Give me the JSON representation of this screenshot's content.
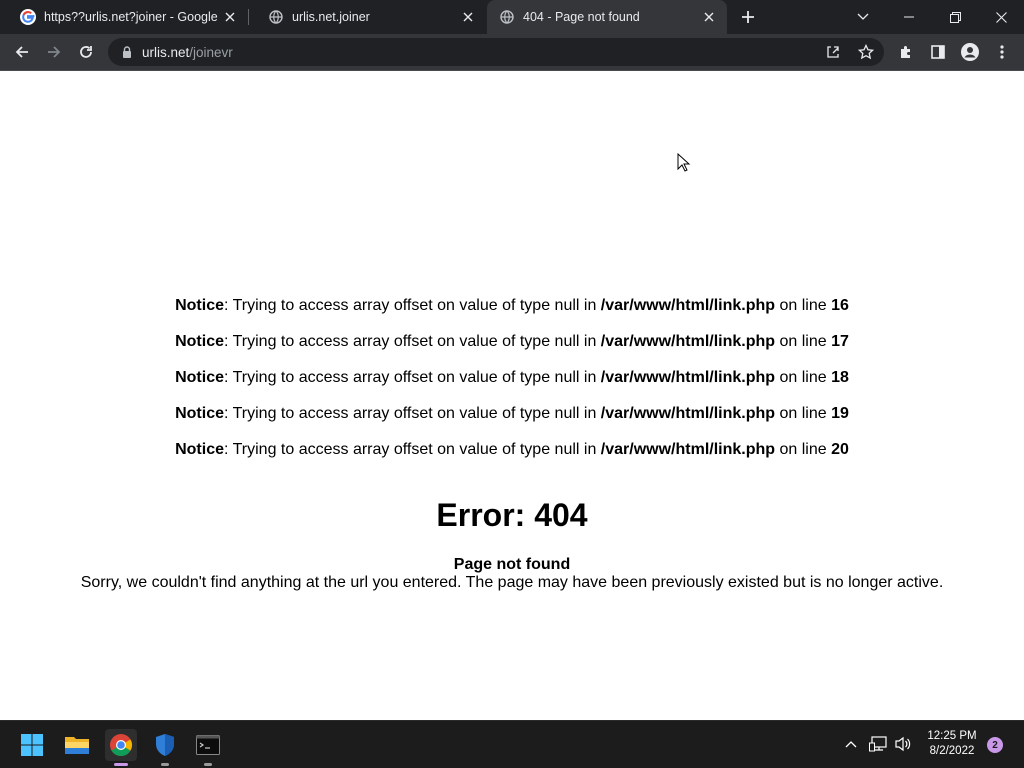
{
  "browser": {
    "tabs": [
      {
        "title": "https??urlis.net?joiner - Google S",
        "icon": "google-icon",
        "active": false
      },
      {
        "title": "urlis.net.joiner",
        "icon": "globe-icon",
        "active": false
      },
      {
        "title": "404 - Page not found",
        "icon": "globe-icon",
        "active": true
      }
    ],
    "address": {
      "host": "urlis.net",
      "path": "/joinevr"
    }
  },
  "page": {
    "notices": [
      {
        "label": "Notice",
        "message": ": Trying to access array offset on value of type null in ",
        "file": "/var/www/html/link.php",
        "on_line": " on line ",
        "line": "16"
      },
      {
        "label": "Notice",
        "message": ": Trying to access array offset on value of type null in ",
        "file": "/var/www/html/link.php",
        "on_line": " on line ",
        "line": "17"
      },
      {
        "label": "Notice",
        "message": ": Trying to access array offset on value of type null in ",
        "file": "/var/www/html/link.php",
        "on_line": " on line ",
        "line": "18"
      },
      {
        "label": "Notice",
        "message": ": Trying to access array offset on value of type null in ",
        "file": "/var/www/html/link.php",
        "on_line": " on line ",
        "line": "19"
      },
      {
        "label": "Notice",
        "message": ": Trying to access array offset on value of type null in ",
        "file": "/var/www/html/link.php",
        "on_line": " on line ",
        "line": "20"
      }
    ],
    "error_title": "Error: 404",
    "not_found_heading": "Page not found",
    "not_found_message": "Sorry, we couldn't find anything at the url you entered. The page may have been previously existed but is no longer active."
  },
  "taskbar": {
    "apps": [
      "windows-start-icon",
      "file-explorer-icon",
      "chrome-icon",
      "windows-security-icon",
      "terminal-icon"
    ],
    "time": "12:25 PM",
    "date": "8/2/2022",
    "notification_count": "2"
  },
  "colors": {
    "titlebar": "#202124",
    "toolbar": "#35363a",
    "taskbar": "#1c1c1c",
    "accent": "#c998e8"
  }
}
